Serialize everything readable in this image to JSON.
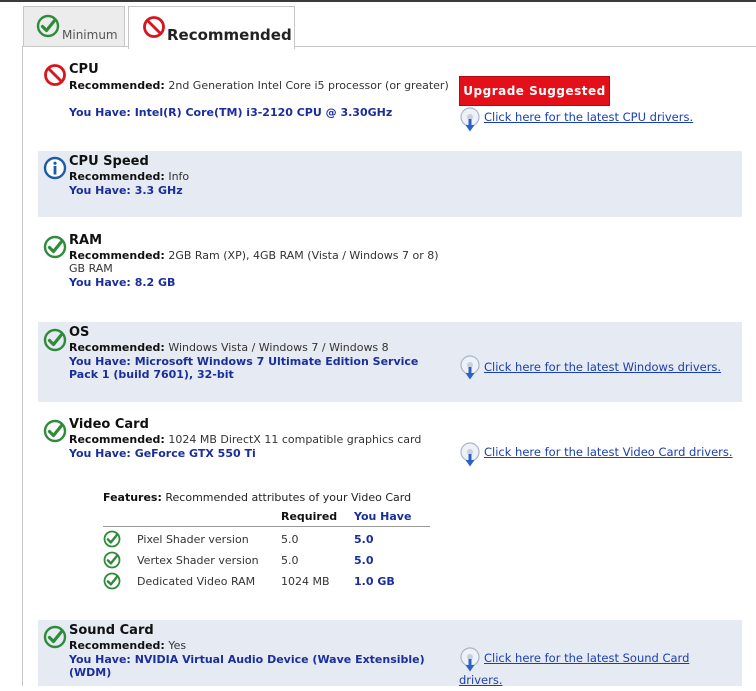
{
  "tabs": [
    {
      "label": "Minimum",
      "icon": "check-icon"
    },
    {
      "label": "Recommended",
      "icon": "no-icon"
    }
  ],
  "common": {
    "recommended_prefix": "Recommended:",
    "you_have_prefix": "You Have:"
  },
  "sections": {
    "cpu": {
      "title": "CPU",
      "status_icon": "no-icon",
      "recommended": "2nd Generation Intel Core i5 processor (or greater)",
      "you_have": "Intel(R) Core(TM) i3-2120 CPU @ 3.30GHz",
      "action_button": "Upgrade Suggested",
      "driver_link": "Click here for the latest CPU drivers."
    },
    "cpu_speed": {
      "title": "CPU Speed",
      "status_icon": "info-icon",
      "recommended": "Info",
      "you_have": "3.3 GHz"
    },
    "ram": {
      "title": "RAM",
      "status_icon": "check-icon",
      "recommended": "2GB Ram (XP), 4GB RAM (Vista / Windows 7 or 8) GB RAM",
      "you_have": "8.2 GB"
    },
    "os": {
      "title": "OS",
      "status_icon": "check-icon",
      "recommended": "Windows Vista / Windows 7 / Windows 8",
      "you_have": "Microsoft Windows 7 Ultimate Edition Service Pack 1 (build 7601), 32-bit",
      "driver_link": "Click here for the latest Windows drivers."
    },
    "video_card": {
      "title": "Video Card",
      "status_icon": "check-icon",
      "recommended": "1024 MB DirectX 11 compatible graphics card",
      "you_have": "GeForce GTX 550 Ti",
      "driver_link": "Click here for the latest Video Card drivers.",
      "features": {
        "heading": "Features:",
        "subheading": "Recommended attributes of your Video Card",
        "columns": {
          "required": "Required",
          "you_have": "You Have"
        },
        "rows": [
          {
            "name": "Pixel Shader version",
            "required": "5.0",
            "you_have": "5.0"
          },
          {
            "name": "Vertex Shader version",
            "required": "5.0",
            "you_have": "5.0"
          },
          {
            "name": "Dedicated Video RAM",
            "required": "1024 MB",
            "you_have": "1.0 GB"
          }
        ]
      }
    },
    "sound_card": {
      "title": "Sound Card",
      "status_icon": "check-icon",
      "recommended": "Yes",
      "you_have": "NVIDIA Virtual Audio Device (Wave Extensible) (WDM)",
      "driver_link": "Click here for the latest Sound Card drivers."
    }
  },
  "colors": {
    "check_green": "#2e8b3a",
    "no_red": "#d9141c",
    "info_blue": "#1d5aa8",
    "you_have_blue": "#1a2e9c",
    "upgrade_red": "#e3101a",
    "shaded_bg": "#e6eaf2"
  }
}
